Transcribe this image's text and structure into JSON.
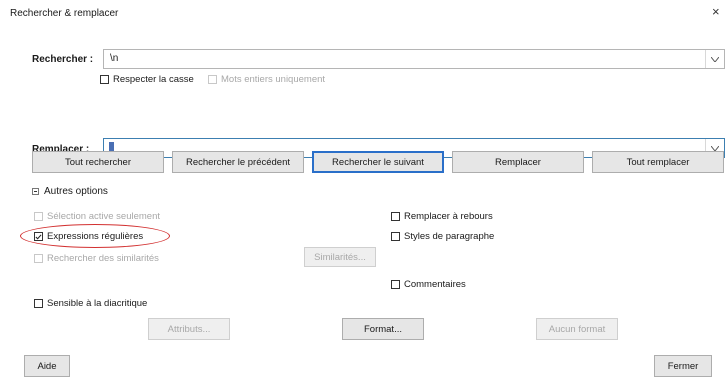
{
  "window": {
    "title": "Rechercher & remplacer",
    "close_glyph": "×"
  },
  "search": {
    "label": "Rechercher :",
    "value": "\\n"
  },
  "replace": {
    "label": "Remplacer :",
    "value": ""
  },
  "options_row1": {
    "match_case": {
      "label": "Respecter la casse",
      "checked": false,
      "enabled": true
    },
    "whole_words": {
      "label": "Mots entiers uniquement",
      "checked": false,
      "enabled": false
    }
  },
  "buttons": {
    "find_all": "Tout rechercher",
    "find_prev": "Rechercher le précédent",
    "find_next": "Rechercher le suivant",
    "replace": "Remplacer",
    "replace_all": "Tout remplacer"
  },
  "other_options": {
    "expander_label": "Autres options",
    "current_selection": "Sélection active seulement",
    "regex": "Expressions régulières",
    "similarity": "Rechercher des similarités",
    "similarity_button": "Similarités...",
    "backwards": "Remplacer à rebours",
    "paragraph_styles": "Styles de paragraphe",
    "comments": "Commentaires",
    "diacritic": "Sensible à la diacritique",
    "attributes_button": "Attributs...",
    "format_button": "Format...",
    "no_format_button": "Aucun format"
  },
  "footer": {
    "help": "Aide",
    "close": "Fermer"
  },
  "colors": {
    "accent": "#2a6fc9",
    "highlight_ellipse": "#d23030"
  }
}
